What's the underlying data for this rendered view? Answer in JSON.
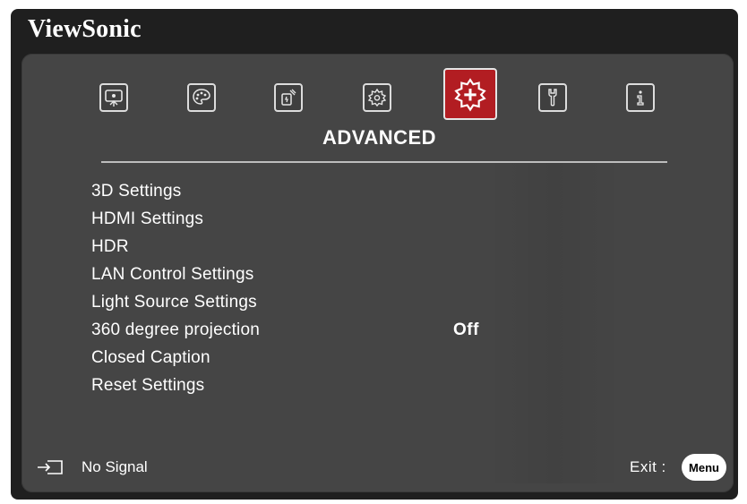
{
  "brand": "ViewSonic",
  "tabs": [
    {
      "icon": "display-icon",
      "active": false
    },
    {
      "icon": "palette-icon",
      "active": false
    },
    {
      "icon": "power-management-icon",
      "active": false
    },
    {
      "icon": "gear-icon",
      "active": false
    },
    {
      "icon": "advanced-gear-icon",
      "active": true
    },
    {
      "icon": "wrench-icon",
      "active": false
    },
    {
      "icon": "info-icon",
      "active": false
    }
  ],
  "section": {
    "title": "ADVANCED"
  },
  "menu": {
    "items": [
      {
        "label": "3D Settings"
      },
      {
        "label": "HDMI Settings"
      },
      {
        "label": "HDR"
      },
      {
        "label": "LAN Control Settings"
      },
      {
        "label": "Light Source Settings"
      },
      {
        "label": "360 degree projection",
        "value": "Off"
      },
      {
        "label": "Closed Caption"
      },
      {
        "label": "Reset Settings"
      }
    ]
  },
  "footer": {
    "status": "No Signal",
    "exit_label": "Exit :",
    "menu_button": "Menu"
  },
  "colors": {
    "accent": "#b21d22",
    "panel": "#454545",
    "frame": "#1f1f1f",
    "text": "#ffffff"
  }
}
